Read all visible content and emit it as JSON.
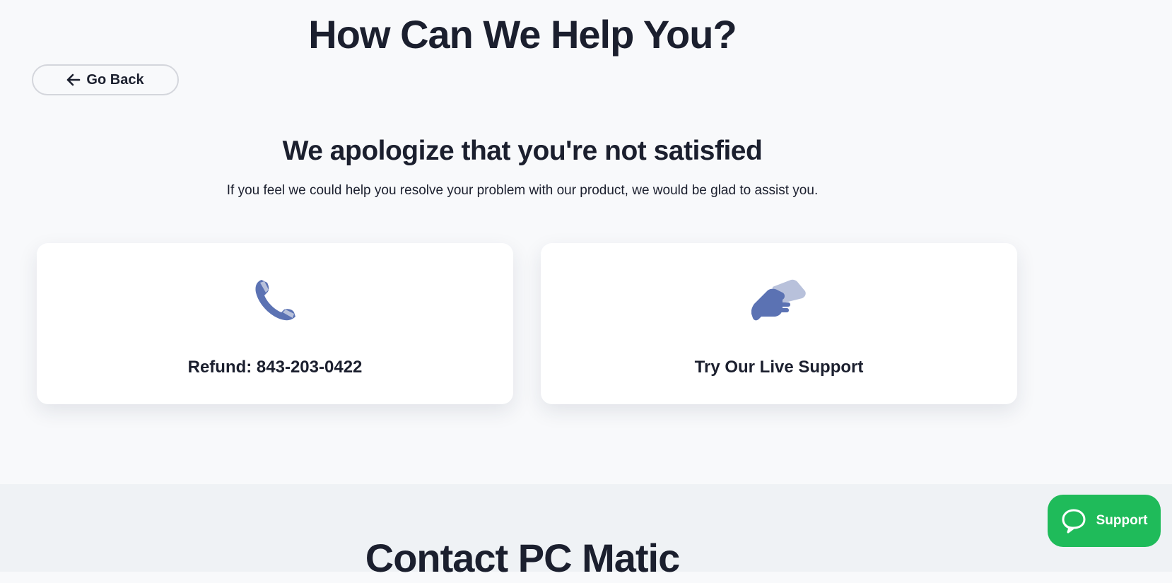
{
  "page": {
    "title": "How Can We Help You?"
  },
  "nav": {
    "go_back_label": "Go Back"
  },
  "apology": {
    "heading": "We apologize that you're not satisfied",
    "subtext": "If you feel we could help you resolve your problem with our product, we would be glad to assist you."
  },
  "cards": [
    {
      "label": "Refund: 843-203-0422",
      "icon": "phone-icon"
    },
    {
      "label": "Try Our Live Support",
      "icon": "handshake-icon"
    }
  ],
  "contact": {
    "heading": "Contact PC Matic"
  },
  "support_widget": {
    "label": "Support",
    "icon": "chat-bubble-icon"
  },
  "colors": {
    "background": "#f8f9fb",
    "section_bg": "#eff2f5",
    "text": "#1b1f2e",
    "icon_primary": "#5b72b3",
    "icon_secondary": "#b8c1db",
    "support_green": "#1fbb5a"
  }
}
